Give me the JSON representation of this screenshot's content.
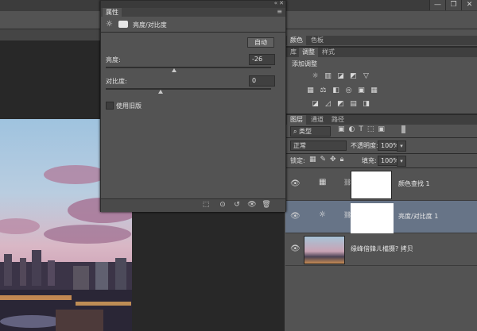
{
  "window": {
    "minimize": "—",
    "restore": "❐",
    "close": "✕"
  },
  "properties_panel": {
    "tab_label": "属性",
    "title": "亮度/对比度",
    "auto_button": "自动",
    "brightness_label": "亮度:",
    "brightness_value": "-26",
    "contrast_label": "对比度:",
    "contrast_value": "0",
    "legacy_label": "使用旧版",
    "brightness_range": [
      -150,
      150
    ],
    "contrast_range": [
      -50,
      100
    ]
  },
  "swatches_row": {
    "tabs": [
      "颜色",
      "色板"
    ]
  },
  "adjustments": {
    "tabs": [
      "库",
      "调整",
      "样式"
    ],
    "heading": "添加调整",
    "row1": [
      "☼",
      "▥",
      "◪",
      "◩",
      "▽"
    ],
    "row2": [
      "▦",
      "⚖",
      "◧",
      "◎",
      "▣",
      "▦"
    ],
    "row3": [
      "◪",
      "◿",
      "◩",
      "▤",
      "◨"
    ]
  },
  "layers_panel": {
    "tabs": [
      "图层",
      "通道",
      "路径"
    ],
    "filter_label": "类型",
    "blend_mode": "正常",
    "opacity_label": "不透明度:",
    "opacity_value": "100%",
    "lock_label": "锁定:",
    "fill_label": "填充:",
    "fill_value": "100%",
    "layers": [
      {
        "name": "颜色查找 1",
        "icon": "▦"
      },
      {
        "name": "亮度/对比度 1",
        "icon": "☼"
      },
      {
        "name": "缘峰偣鍏ㄦ櫙摄? 拷贝",
        "icon": ""
      }
    ]
  },
  "colors": {
    "selected_layer": "#677487",
    "panel": "#535353"
  }
}
